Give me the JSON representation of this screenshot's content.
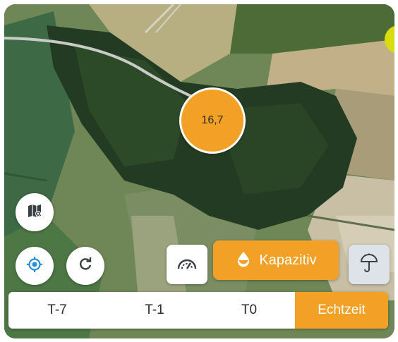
{
  "map": {
    "marker_value": "16,7"
  },
  "controls": {
    "layers_icon": "map-layers-icon",
    "locate_icon": "my-location-icon",
    "refresh_icon": "refresh-icon",
    "gauge_icon": "gauge-icon",
    "capacitive_icon": "droplet-icon",
    "capacitive_label": "Kapazitiv",
    "umbrella_icon": "umbrella-icon"
  },
  "time_selector": {
    "options": [
      "T-7",
      "T-1",
      "T0",
      "Echtzeit"
    ],
    "selected": "Echtzeit"
  },
  "colors": {
    "accent": "#f2a126",
    "indicator_yellow": "#d9dd10",
    "button_bg": "#ffffff",
    "disabled_bg": "#dde3e8",
    "icon_blue": "#2a8fd6"
  }
}
